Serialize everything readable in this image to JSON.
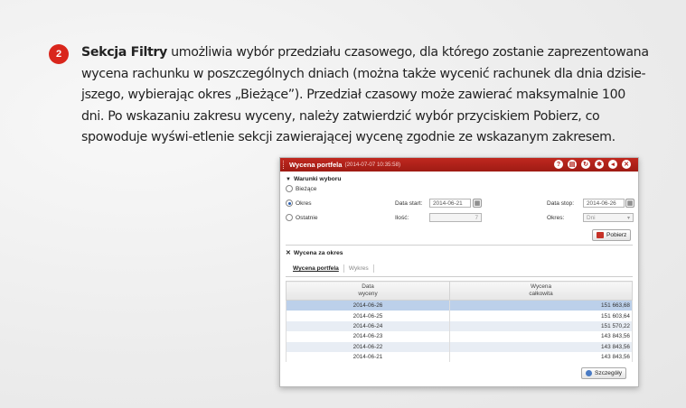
{
  "step": {
    "number": "2"
  },
  "intro": {
    "lead": "Sekcja Filtry",
    "text": " umożliwia wybór przedziału czasowego, dla którego zostanie zaprezentowana wycena rachunku w poszczególnych dniach (można także wycenić rachunek dla dnia dzisie-jszego, wybierając okres „Bieżące”). Przedział czasowy może zawierać maksymalnie 100 dni. Po wskazaniu zakresu wyceny, należy zatwierdzić wybór przyciskiem Pobierz, co spowoduje wyświ-etlenie sekcji zawierającej wycenę zgodnie ze wskazanym zakresem."
  },
  "window": {
    "title": "Wycena portfela",
    "timestamp": "(2014-07-07 10:35:58)",
    "icons": [
      "help-icon",
      "print-icon",
      "refresh-icon",
      "settings-icon",
      "minimize-icon",
      "close-icon"
    ],
    "icon_glyphs": [
      "?",
      "▤",
      "↻",
      "✱",
      "◂",
      "✕"
    ]
  },
  "filters": {
    "section_title": "Warunki wyboru",
    "radio_current": "Bieżące",
    "radio_period": "Okres",
    "radio_last": "Ostatnie",
    "date_start_label": "Data start:",
    "date_start_value": "2014-06-21",
    "date_stop_label": "Data stop:",
    "date_stop_value": "2014-06-26",
    "count_label": "Ilość:",
    "count_value": "7",
    "period_label": "Okres:",
    "period_value": "Dni",
    "fetch_button": "Pobierz"
  },
  "results": {
    "section_title": "Wycena za okres",
    "tab_valuation": "Wycena portfela",
    "tab_chart": "Wykres",
    "col_date_l1": "Data",
    "col_date_l2": "wyceny",
    "col_value_l1": "Wycena",
    "col_value_l2": "całkowita",
    "rows": [
      {
        "date": "2014-06-26",
        "value": "151 663,68"
      },
      {
        "date": "2014-06-25",
        "value": "151 603,64"
      },
      {
        "date": "2014-06-24",
        "value": "151 570,22"
      },
      {
        "date": "2014-06-23",
        "value": "143 843,56"
      },
      {
        "date": "2014-06-22",
        "value": "143 843,56"
      },
      {
        "date": "2014-06-21",
        "value": "143 843,56"
      }
    ],
    "details_button": "Szczegóły"
  },
  "colors": {
    "accent": "#d9261c",
    "titlebar": "#b02118",
    "selected_row": "#bcd0ea"
  }
}
